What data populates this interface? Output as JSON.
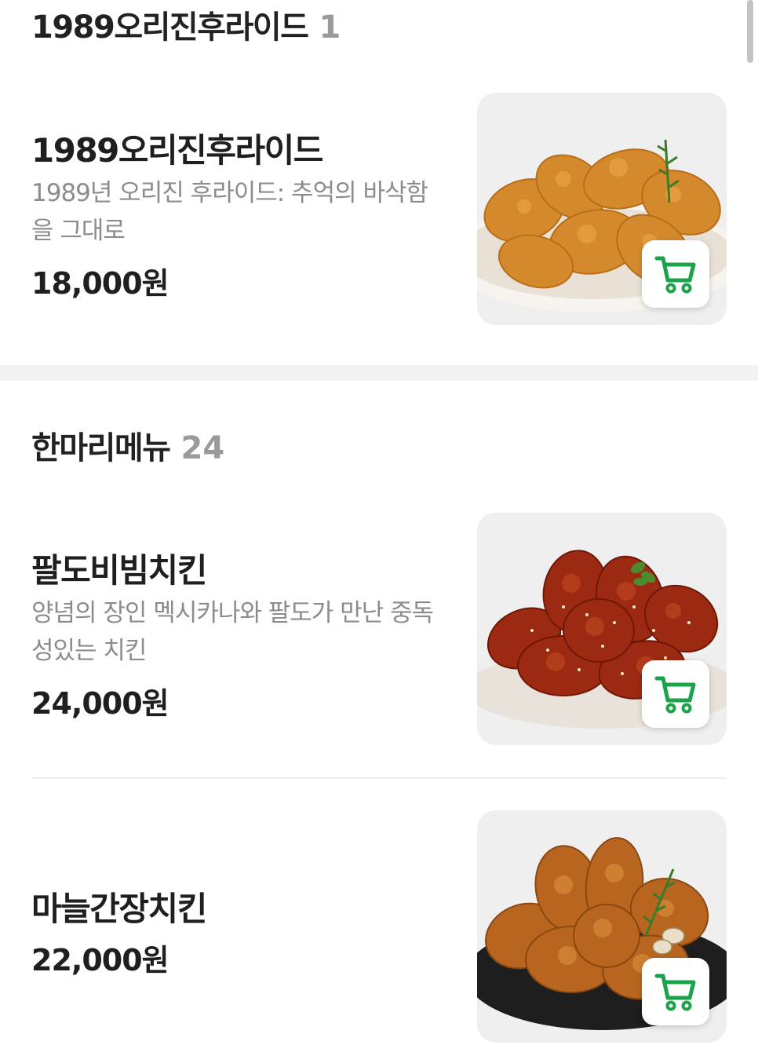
{
  "sections": [
    {
      "title": "1989오리진후라이드",
      "count": "1",
      "items": [
        {
          "name": "1989오리진후라이드",
          "desc": "1989년 오리진 후라이드: 추억의 바삭함을 그대로",
          "price": "18,000원",
          "image": "fried-chicken-image"
        }
      ]
    },
    {
      "title": "한마리메뉴",
      "count": "24",
      "items": [
        {
          "name": "팔도비빔치킨",
          "desc": "양념의 장인 멕시카나와 팔도가 만난 중독성있는 치킨",
          "price": "24,000원",
          "image": "spicy-chicken-image"
        },
        {
          "name": "마늘간장치킨",
          "price": "22,000원",
          "image": "garlic-soy-chicken-image"
        }
      ]
    }
  ],
  "cart_icon": "shopping-cart-icon",
  "colors": {
    "accent": "#1aa34a",
    "title_text": "#222222",
    "desc_text": "#8c8c8c",
    "count_text": "#9a9a9a",
    "divider": "#f2f2f2"
  }
}
